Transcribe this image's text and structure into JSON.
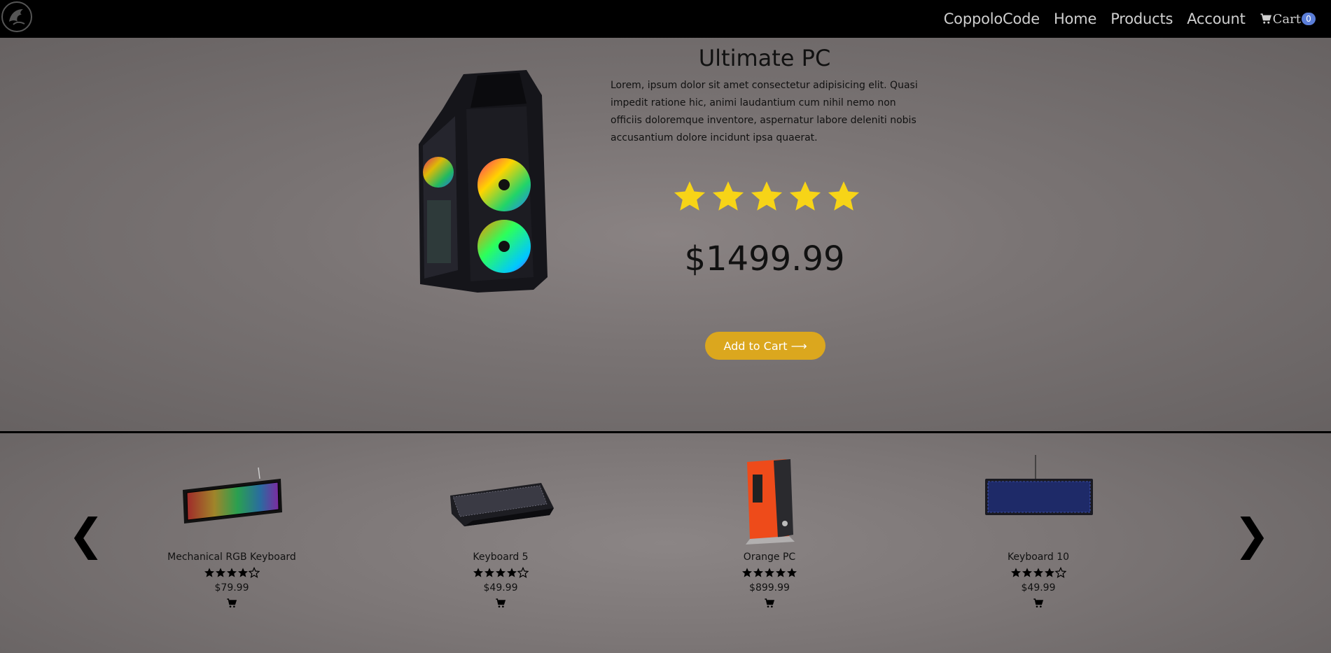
{
  "nav": {
    "brand": "CoppoloCode",
    "links": [
      "Home",
      "Products",
      "Account"
    ],
    "cart_label": "Cart",
    "cart_count": "0"
  },
  "hero": {
    "title": "Ultimate PC",
    "description": "Lorem, ipsum dolor sit amet consectetur adipisicing elit. Quasi impedit ratione hic, animi laudantium cum nihil nemo non officiis doloremque inventore, aspernatur labore deleniti nobis accusantium dolore incidunt ipsa quaerat.",
    "rating": 5,
    "price": "$1499.99",
    "add_to_cart": "Add to Cart ⟶"
  },
  "carousel": {
    "prev": "❮",
    "next": "❯",
    "items": [
      {
        "name": "Mechanical RGB Keyboard",
        "rating": 4,
        "price": "$79.99",
        "image": "keyboard-rgb"
      },
      {
        "name": "Keyboard 5",
        "rating": 4,
        "price": "$49.99",
        "image": "keyboard-black"
      },
      {
        "name": "Orange PC",
        "rating": 5,
        "price": "$899.99",
        "image": "orange-pc"
      },
      {
        "name": "Keyboard 10",
        "rating": 4,
        "price": "$49.99",
        "image": "keyboard-blue"
      }
    ]
  },
  "colors": {
    "accent": "#dba71e",
    "star": "#f7d417",
    "badge": "#5b7ed8"
  }
}
